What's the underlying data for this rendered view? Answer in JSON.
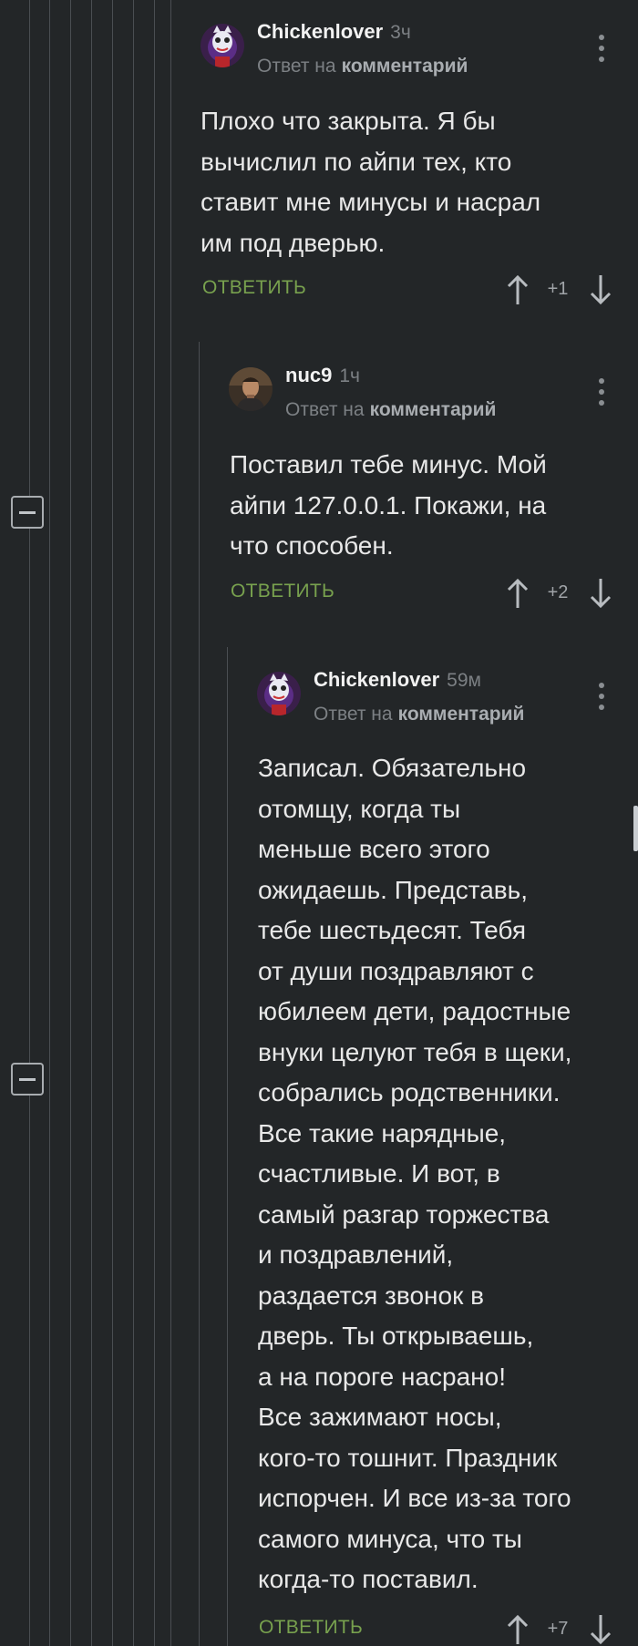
{
  "comments": [
    {
      "author": "Chickenlover",
      "time": "3ч",
      "reply_prefix": "Ответ на",
      "reply_target": "комментарий",
      "text": "Плохо что закрыта. Я бы\nвычислил по айпи тех, кто\nставит мне минусы и насрал\nим под дверью.",
      "reply_label": "ОТВЕТИТЬ",
      "score": "+1",
      "avatar": "cartoon-character-avatar"
    },
    {
      "author": "nuc9",
      "time": "1ч",
      "reply_prefix": "Ответ на",
      "reply_target": "комментарий",
      "text": "Поставил тебе минус. Мой\nайпи 127.0.0.1. Покажи, на\nчто способен.",
      "reply_label": "ОТВЕТИТЬ",
      "score": "+2",
      "avatar": "man-photo-avatar"
    },
    {
      "author": "Chickenlover",
      "time": "59м",
      "reply_prefix": "Ответ на",
      "reply_target": "комментарий",
      "text": "Записал. Обязательно\nотомщу, когда ты\nменьше всего этого\nожидаешь. Представь,\nтебе шестьдесят. Тебя\nот души поздравляют с\nюбилеем дети, радостные\nвнуки целуют тебя в щеки,\nсобрались родственники.\nВсе такие нарядные,\nсчастливые. И вот, в\nсамый разгар торжества\nи поздравлений,\nраздается звонок в\nдверь. Ты открываешь,\nа на пороге насрано!\nВсе зажимают носы,\nкого-то тошнит. Праздник\nиспорчен. И все из-за того\nсамого минуса, что ты\nкогда-то поставил.",
      "reply_label": "ОТВЕТИТЬ",
      "score": "+7",
      "avatar": "cartoon-character-avatar"
    }
  ],
  "colors": {
    "background": "#232628",
    "reply_link": "#78a14e",
    "thread_line": "#4a4e52"
  },
  "icons": [
    "collapse-icon",
    "arrow-up-icon",
    "arrow-down-icon",
    "more-vertical-icon"
  ]
}
